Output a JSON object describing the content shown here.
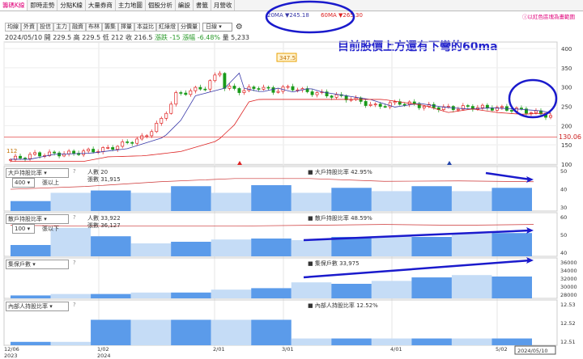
{
  "tabs": [
    "籌碼K線",
    "即時走勢",
    "分點K線",
    "大量券商",
    "主力地圖",
    "個股分析",
    "編設",
    "書籤",
    "月營收"
  ],
  "ma_legend": {
    "ma20": "20MA ▼245.18",
    "ma60": "60MA ▼265.30"
  },
  "right_link": "ⓘ以紅色區塊為畫範圍",
  "toolbar": {
    "buttons": [
      "均線",
      "外資",
      "投信",
      "主力",
      "融資",
      "布林",
      "籌集",
      "擇量",
      "本益比",
      "紅綠燈",
      "分價量"
    ],
    "period": "日線",
    "settings_icon": "gear-icon"
  },
  "quote": {
    "date": "2024/05/10",
    "open": "開 229.5",
    "high": "高 229.5",
    "low": "低 212",
    "close": "收 216.5",
    "change": "漲跌 -15",
    "pct": "漲幅 -6.48%",
    "vol": "量 5,233"
  },
  "annotation": "目前股價上方還有下彎的60ma",
  "price_marks": {
    "high_label": "347.5",
    "low_label": "112",
    "last": "130.06"
  },
  "price_axis": [
    "400",
    "350",
    "300",
    "250",
    "200",
    "150",
    "100"
  ],
  "panels": [
    {
      "title": "大戶持股比率",
      "select": "400",
      "unit": "張以上",
      "info1": "人數 20",
      "info2": "張數 31,915",
      "label": "大戶持股比率 42.95%",
      "axis": [
        "50",
        "40",
        "30"
      ]
    },
    {
      "title": "散戶持股比率",
      "select": "100",
      "unit": "張以下",
      "info1": "人數 33,922",
      "info2": "張數 36,127",
      "label": "散戶持股比率 48.59%",
      "axis": [
        "60",
        "50",
        "40"
      ]
    },
    {
      "title": "集保戶數",
      "label": "集保戶數 33,975",
      "axis": [
        "36000",
        "34000",
        "32000",
        "30000",
        "28000"
      ]
    },
    {
      "title": "內部人持股比率",
      "label": "內部人持股比率 12.52%",
      "axis": [
        "12.53",
        "12.52",
        "12.51"
      ]
    }
  ],
  "xaxis": [
    {
      "top": "12/06",
      "bottom": "2023"
    },
    {
      "top": "1/02",
      "bottom": "2024"
    },
    {
      "top": "2/01",
      "bottom": ""
    },
    {
      "top": "3/01",
      "bottom": ""
    },
    {
      "top": "4/01",
      "bottom": ""
    },
    {
      "top": "5/02",
      "bottom": ""
    }
  ],
  "current_date": "2024/05/10",
  "colors": {
    "up": "#e02020",
    "down": "#1a9a1a",
    "ma20": "#3838a8",
    "ma60": "#d22",
    "bar": "#5b9bea",
    "bar_light": "#c5dcf6",
    "annot": "#1a1acc"
  },
  "chart_data": [
    {
      "type": "line",
      "title": "",
      "series": [
        {
          "name": "20MA",
          "values": [
            245.18
          ]
        },
        {
          "name": "60MA",
          "values": [
            265.3
          ]
        }
      ],
      "annotations": [
        "347.5",
        "112",
        "130.06"
      ],
      "ylim": [
        100,
        400
      ]
    },
    {
      "type": "bar",
      "title": "大戶持股比率",
      "ylim": [
        30,
        50
      ],
      "last": 42.95
    },
    {
      "type": "bar",
      "title": "散戶持股比率",
      "ylim": [
        40,
        60
      ],
      "last": 48.59
    },
    {
      "type": "bar",
      "title": "集保戶數",
      "ylim": [
        28000,
        36000
      ],
      "last": 33975
    },
    {
      "type": "bar",
      "title": "內部人持股比率",
      "ylim": [
        12.51,
        12.53
      ],
      "last": 12.52
    }
  ]
}
